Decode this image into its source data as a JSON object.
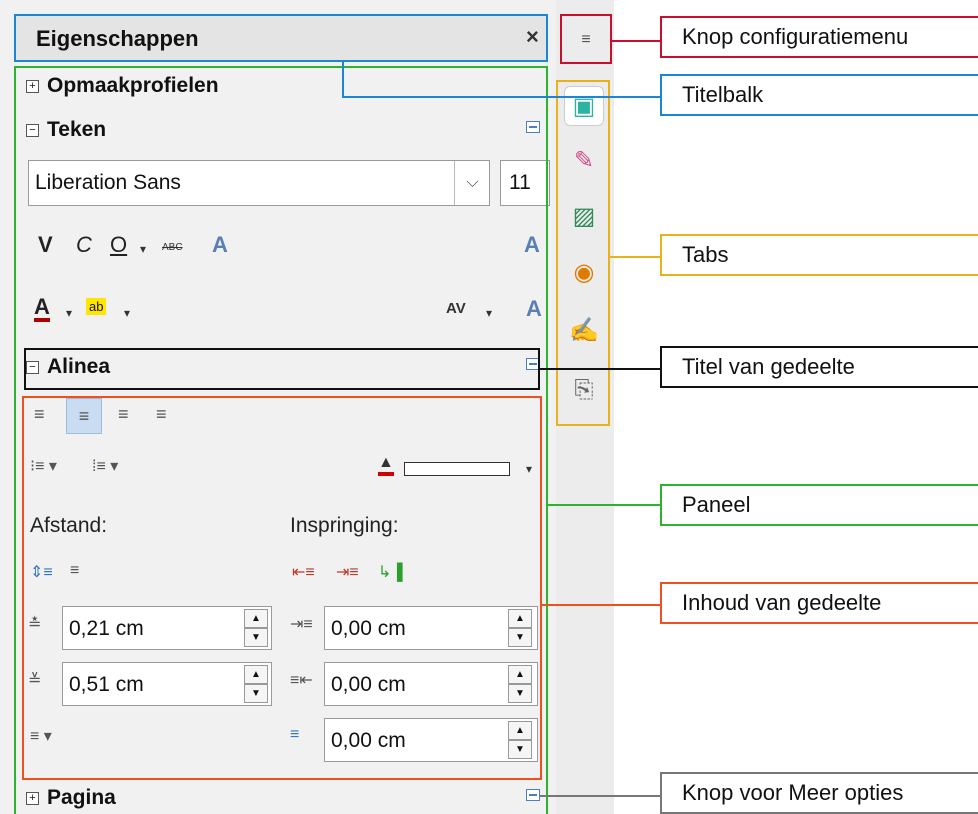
{
  "titlebar": {
    "title": "Eigenschappen",
    "close": "×"
  },
  "menu_button": {
    "glyph": "≡"
  },
  "sections": {
    "styles": "Opmaakprofielen",
    "character": "Teken",
    "paragraph": "Alinea",
    "page": "Pagina"
  },
  "character": {
    "font_name": "Liberation Sans",
    "font_size": "11",
    "bold": "V",
    "italic": "C",
    "underline": "O",
    "strike": "ABC",
    "shadow": "A",
    "font_color": "A",
    "highlight": "ab",
    "spacing": "AV"
  },
  "paragraph": {
    "spacing_label": "Afstand:",
    "indent_label": "Inspringing:",
    "above": "0,21 cm",
    "below": "0,51 cm",
    "indent_before": "0,00 cm",
    "indent_after": "0,00 cm",
    "first_line": "0,00 cm"
  },
  "callouts": {
    "menu": "Knop configuratiemenu",
    "title": "Titelbalk",
    "tabs": "Tabs",
    "deck_title": "Titel van gedeelte",
    "panel": "Paneel",
    "content": "Inhoud van gedeelte",
    "more": "Knop voor Meer opties"
  },
  "colors": {
    "menu": "#c8102e",
    "title": "#1a86d8",
    "tabs": "#e8b21c",
    "deck_title": "#111111",
    "panel": "#2cb52c",
    "content": "#f0501e",
    "more": "#777777"
  }
}
